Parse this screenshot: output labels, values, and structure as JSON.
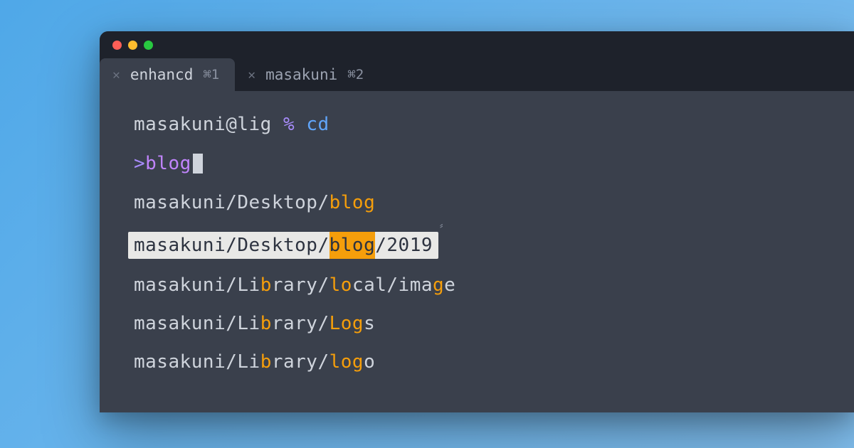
{
  "tabs": [
    {
      "label": "enhancd",
      "shortcut": "⌘1",
      "active": true
    },
    {
      "label": "masakuni",
      "shortcut": "⌘2",
      "active": false
    }
  ],
  "prompt": {
    "userhost": "masakuni@lig ",
    "symbol": "% ",
    "command": "cd"
  },
  "search": {
    "caret": ">",
    "query": "blog"
  },
  "results": [
    {
      "selected": false,
      "segments": [
        {
          "t": "masakuni/Desktop/",
          "hl": false
        },
        {
          "t": "blog",
          "hl": true
        }
      ]
    },
    {
      "selected": true,
      "segments": [
        {
          "t": "masakuni/Desktop/",
          "hl": false
        },
        {
          "t": "blog",
          "hl": true
        },
        {
          "t": "/2019",
          "hl": false
        }
      ]
    },
    {
      "selected": false,
      "segments": [
        {
          "t": "masakuni/Li",
          "hl": false
        },
        {
          "t": "b",
          "hl": true
        },
        {
          "t": "rary/",
          "hl": false
        },
        {
          "t": "lo",
          "hl": true
        },
        {
          "t": "cal/ima",
          "hl": false
        },
        {
          "t": "g",
          "hl": true
        },
        {
          "t": "e",
          "hl": false
        }
      ]
    },
    {
      "selected": false,
      "segments": [
        {
          "t": "masakuni/Li",
          "hl": false
        },
        {
          "t": "b",
          "hl": true
        },
        {
          "t": "rary/",
          "hl": false
        },
        {
          "t": "Log",
          "hl": true
        },
        {
          "t": "s",
          "hl": false
        }
      ]
    },
    {
      "selected": false,
      "segments": [
        {
          "t": "masakuni/Li",
          "hl": false
        },
        {
          "t": "b",
          "hl": true
        },
        {
          "t": "rary/",
          "hl": false
        },
        {
          "t": "log",
          "hl": true
        },
        {
          "t": "o",
          "hl": false
        }
      ]
    }
  ]
}
